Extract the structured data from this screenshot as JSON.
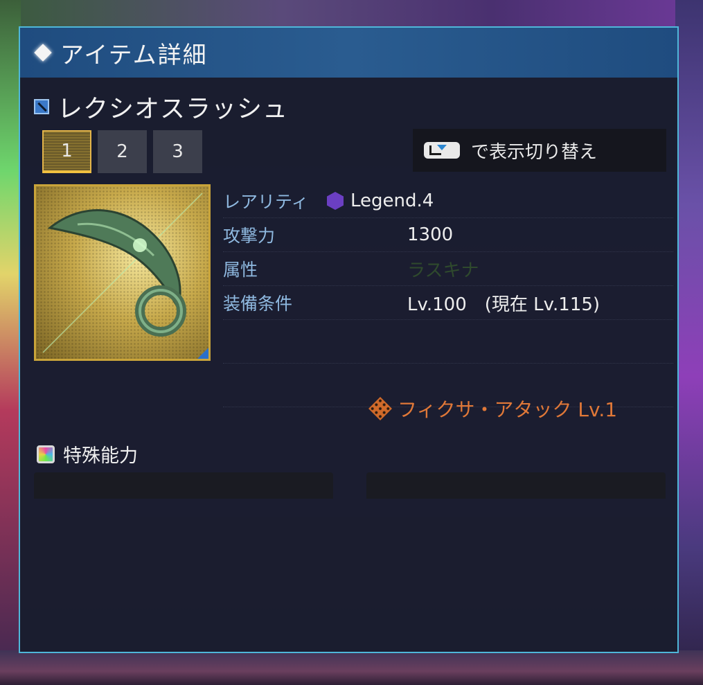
{
  "window": {
    "title": "アイテム詳細"
  },
  "item": {
    "name": "レクシオスラッシュ",
    "tabs": [
      "1",
      "2",
      "3"
    ],
    "active_tab": "1",
    "switch_hint": "で表示切り替え",
    "stats": {
      "rarity_label": "レアリティ",
      "rarity_value": "Legend.4",
      "attack_label": "攻撃力",
      "attack_value": "1300",
      "element_label": "属性",
      "element_value": "ラスキナ",
      "requirement_label": "装備条件",
      "requirement_value": "Lv.100　(現在 Lv.115)"
    },
    "potential": "フィクサ・アタック Lv.1",
    "special_ability_title": "特殊能力"
  },
  "colors": {
    "frame_border": "#4fb7d9",
    "header_bg": "#2a5c90",
    "stat_label": "#8fb9e0",
    "potential_text": "#e07838",
    "active_tab_border": "#e4b54a",
    "rarity_gem": "#6b3fc2"
  },
  "icons": {
    "header": "diamond-icon",
    "weapon_type": "weapon-type-icon",
    "switch_key": "controller-key-icon",
    "rarity": "gem-icon",
    "potential": "potential-icon",
    "special": "special-ability-icon"
  }
}
